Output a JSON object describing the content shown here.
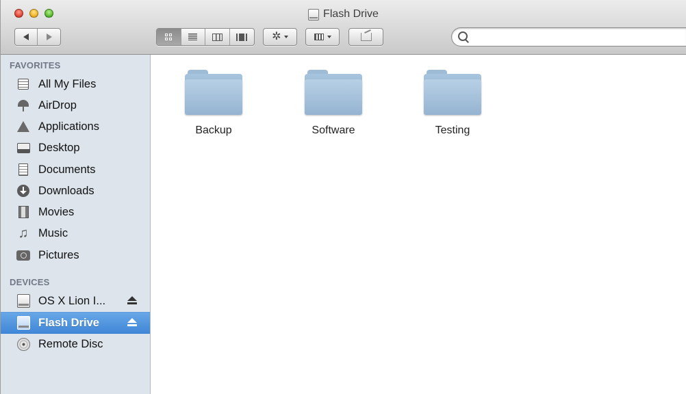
{
  "window": {
    "title": "Flash Drive"
  },
  "toolbar": {
    "search_placeholder": ""
  },
  "sidebar": {
    "favorites_header": "FAVORITES",
    "devices_header": "DEVICES",
    "favorites": [
      {
        "label": "All My Files",
        "icon": "all-files-icon"
      },
      {
        "label": "AirDrop",
        "icon": "airdrop-icon"
      },
      {
        "label": "Applications",
        "icon": "applications-icon"
      },
      {
        "label": "Desktop",
        "icon": "desktop-icon"
      },
      {
        "label": "Documents",
        "icon": "documents-icon"
      },
      {
        "label": "Downloads",
        "icon": "downloads-icon"
      },
      {
        "label": "Movies",
        "icon": "movies-icon"
      },
      {
        "label": "Music",
        "icon": "music-icon"
      },
      {
        "label": "Pictures",
        "icon": "pictures-icon"
      }
    ],
    "devices": [
      {
        "label": "OS X Lion I...",
        "icon": "drive-icon",
        "eject": true
      },
      {
        "label": "Flash Drive",
        "icon": "drive-icon",
        "eject": true,
        "selected": true
      },
      {
        "label": "Remote Disc",
        "icon": "disc-icon",
        "eject": false
      }
    ]
  },
  "content": {
    "folders": [
      {
        "label": "Backup"
      },
      {
        "label": "Software"
      },
      {
        "label": "Testing"
      }
    ]
  },
  "colors": {
    "selection": "#3f86d7",
    "sidebar_bg": "#dde4ec",
    "folder": "#a7c4de"
  }
}
